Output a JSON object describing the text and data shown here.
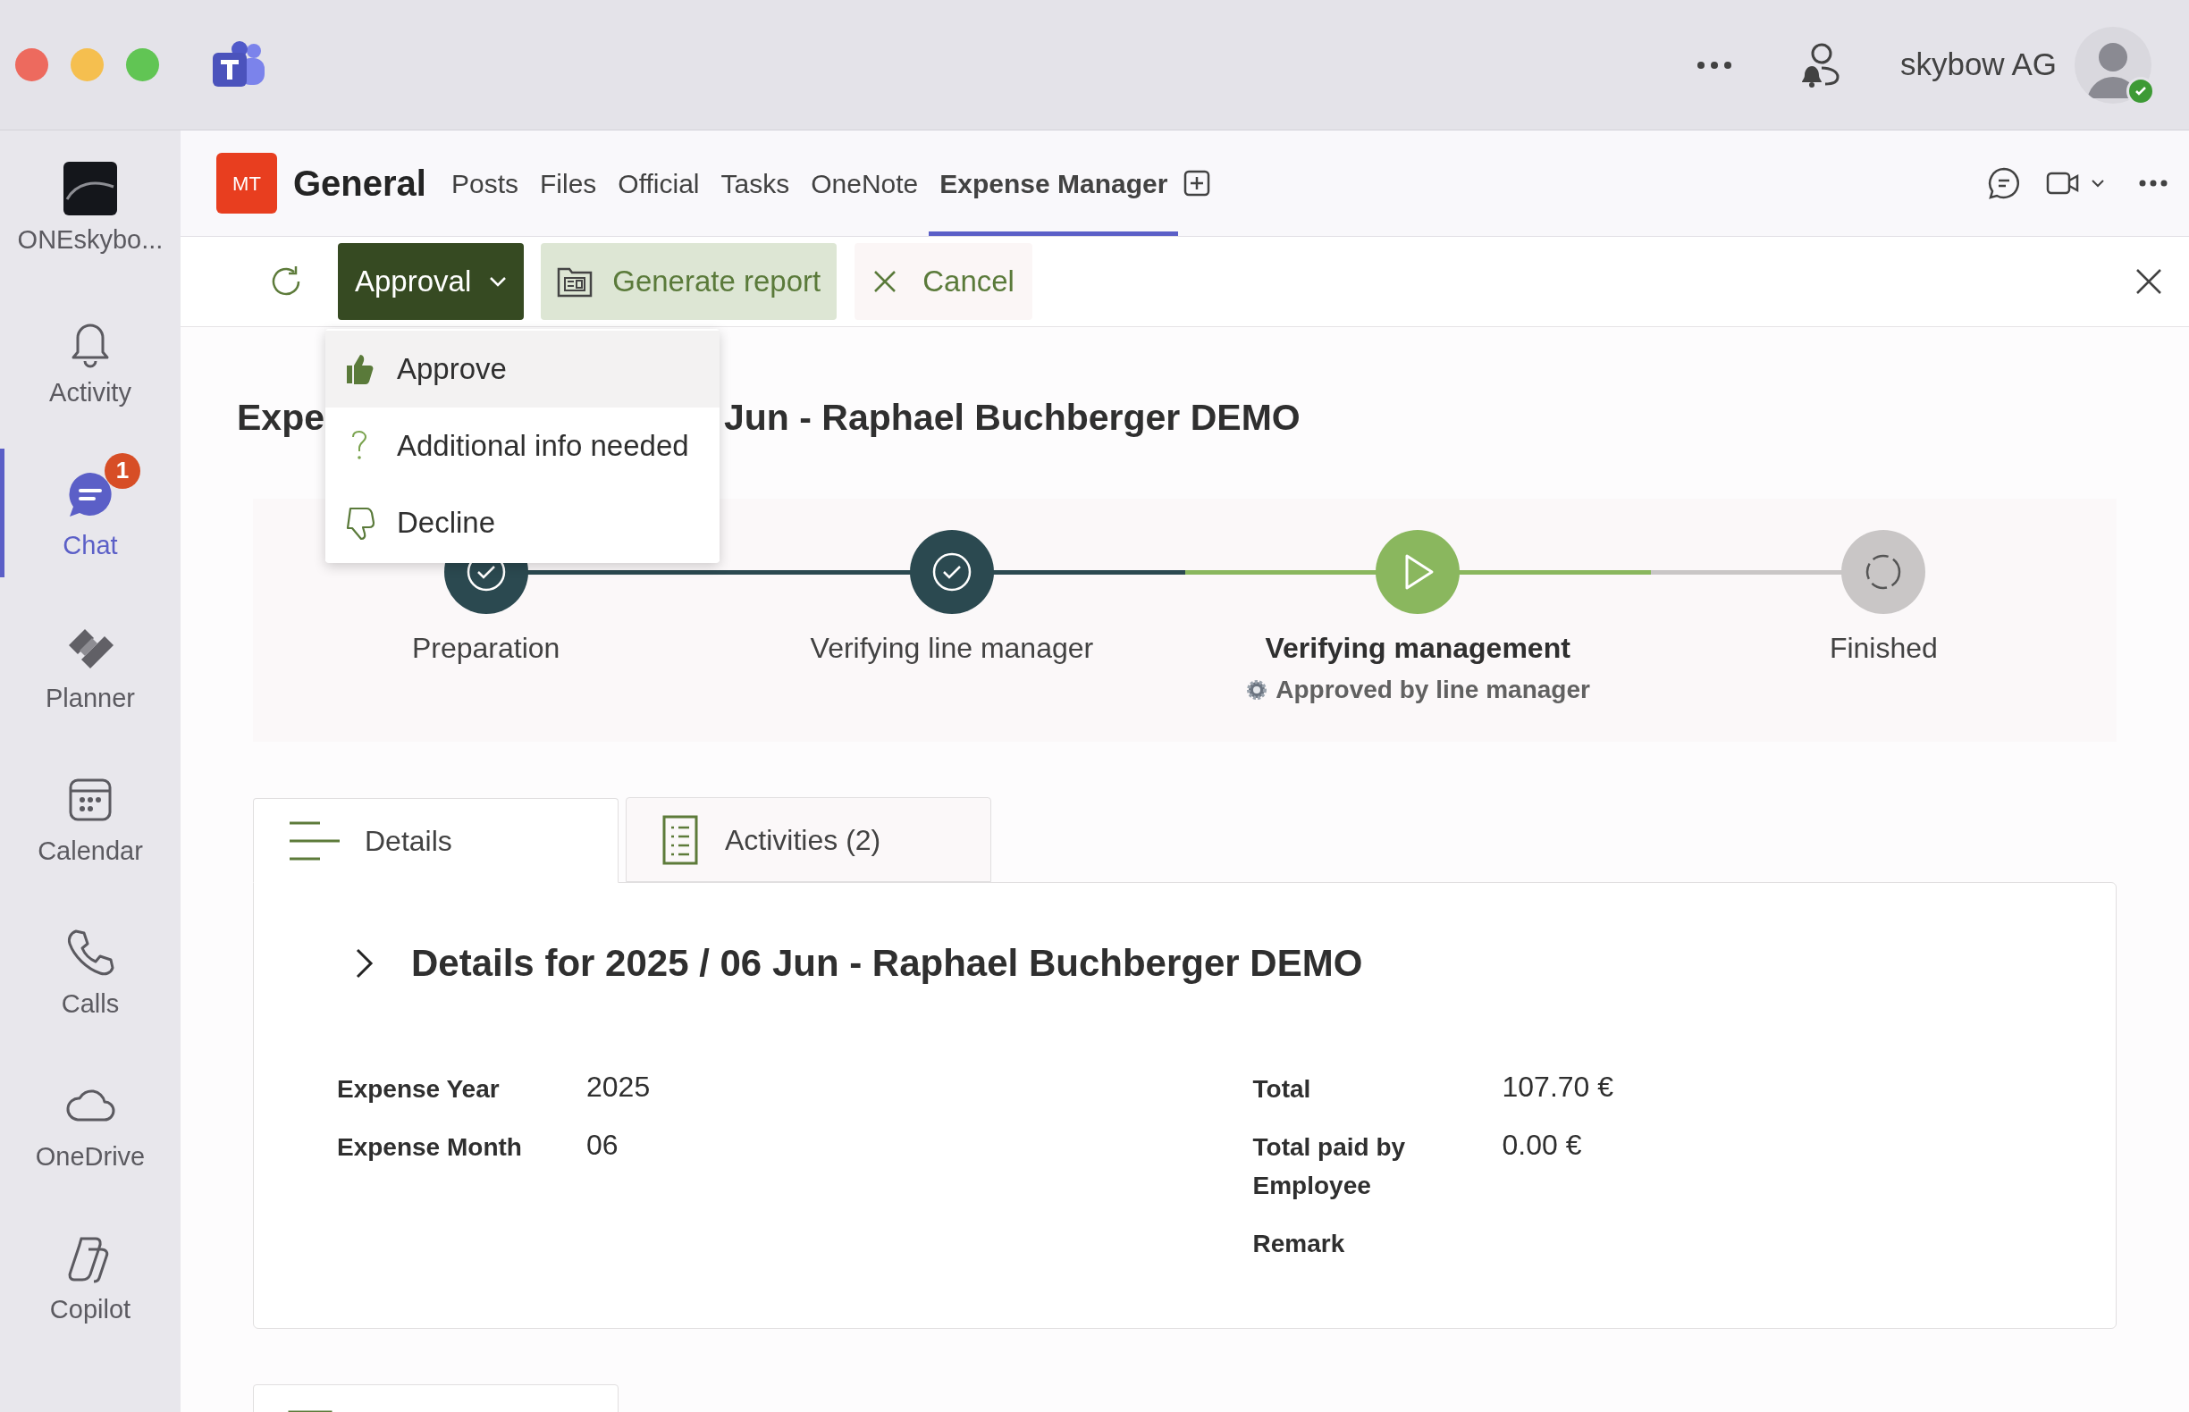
{
  "title_bar": {
    "account": "skybow AG"
  },
  "sidebar": {
    "items": [
      {
        "label": "ONEskybo...",
        "selected": false
      },
      {
        "label": "Activity",
        "selected": false
      },
      {
        "label": "Chat",
        "selected": true,
        "badge": "1"
      },
      {
        "label": "Planner",
        "selected": false
      },
      {
        "label": "Calendar",
        "selected": false
      },
      {
        "label": "Calls",
        "selected": false
      },
      {
        "label": "OneDrive",
        "selected": false
      },
      {
        "label": "Copilot",
        "selected": false
      }
    ]
  },
  "channel": {
    "avatar": "MT",
    "name": "General",
    "tabs": [
      {
        "label": "Posts",
        "selected": false
      },
      {
        "label": "Files",
        "selected": false
      },
      {
        "label": "Official",
        "selected": false
      },
      {
        "label": "Tasks",
        "selected": false
      },
      {
        "label": "OneNote",
        "selected": false
      },
      {
        "label": "Expense Manager",
        "selected": true
      }
    ]
  },
  "toolbar": {
    "approval_button": "Approval",
    "generate_button": "Generate report",
    "cancel_button": "Cancel"
  },
  "menu": {
    "items": [
      {
        "label": "Approve",
        "kind": "approve",
        "selected": true
      },
      {
        "label": "Additional info needed",
        "kind": "info",
        "selected": false
      },
      {
        "label": "Decline",
        "kind": "decline",
        "selected": false
      }
    ]
  },
  "page_title_parts": [
    "Expe",
    "Jun - Raphael Buchberger DEMO"
  ],
  "stepper": {
    "steps": [
      {
        "label": "Preparation",
        "completed": true,
        "active": false
      },
      {
        "label": "Verifying line manager",
        "completed": true,
        "active": false
      },
      {
        "label": "Verifying management",
        "completed": false,
        "active": true,
        "note": "Approved by line manager"
      },
      {
        "label": "Finished",
        "completed": false,
        "active": false
      }
    ]
  },
  "detail_tabs": [
    {
      "label": "Details",
      "selected": true
    },
    {
      "label": "Activities (2)",
      "selected": false
    }
  ],
  "details": {
    "heading": "Details for 2025 / 06 Jun - Raphael Buchberger DEMO",
    "fields_left": [
      {
        "label": "Expense Year",
        "value": "2025"
      },
      {
        "label": "Expense Month",
        "value": "06"
      }
    ],
    "fields_right": [
      {
        "label": "Total",
        "value": "107.70 €"
      },
      {
        "label": "Total paid by Employee",
        "value": "0.00 €"
      },
      {
        "label": "Remark"
      }
    ]
  }
}
